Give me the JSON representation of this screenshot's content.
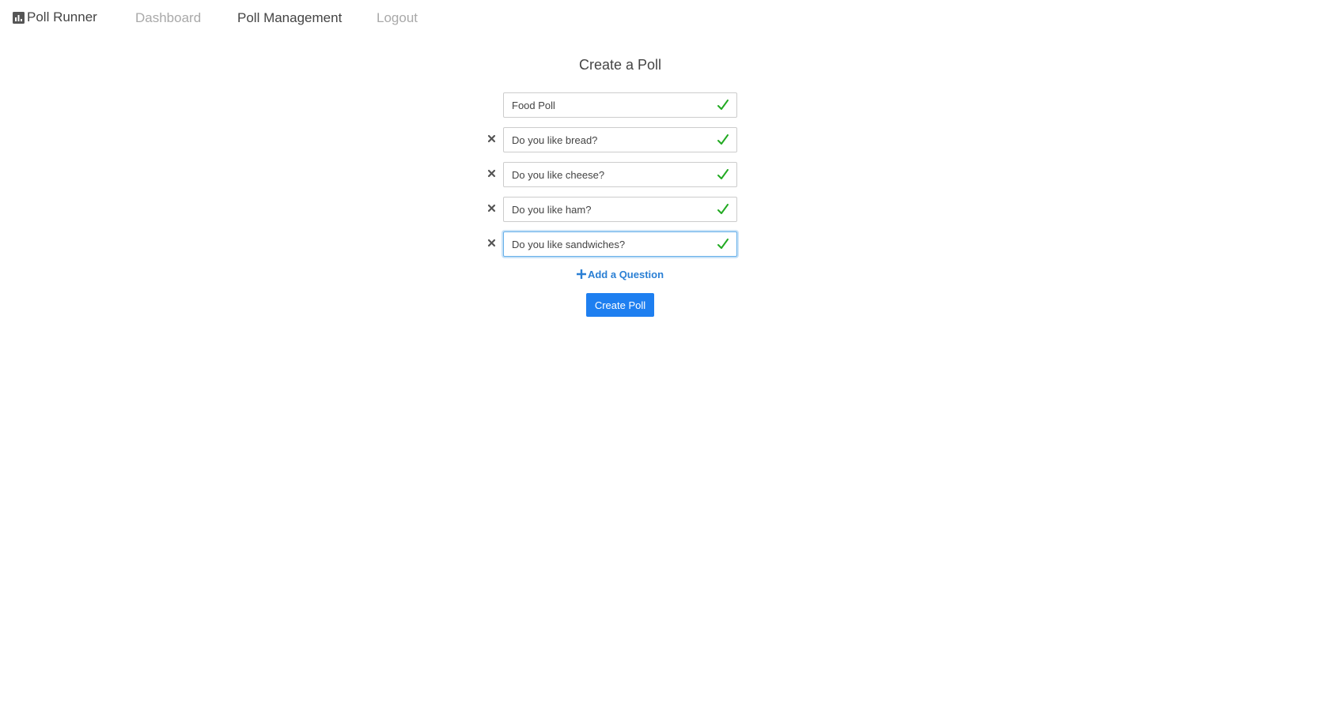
{
  "nav": {
    "brand": "Poll Runner",
    "brand_icon": "bar-chart-icon",
    "links": [
      "Dashboard",
      "Poll Management",
      "Logout"
    ]
  },
  "form": {
    "title": "Create a Poll",
    "poll_name": "Food Poll",
    "questions": [
      "Do you like bread?",
      "Do you like cheese?",
      "Do you like ham?",
      "Do you like sandwiches?"
    ],
    "add_question_label": "Add a Question",
    "create_button_label": "Create Poll"
  },
  "colors": {
    "accent": "#1e7ff0",
    "link": "#2a7fd4",
    "valid": "#22aa22",
    "muted_nav": "#a9a9a9"
  }
}
